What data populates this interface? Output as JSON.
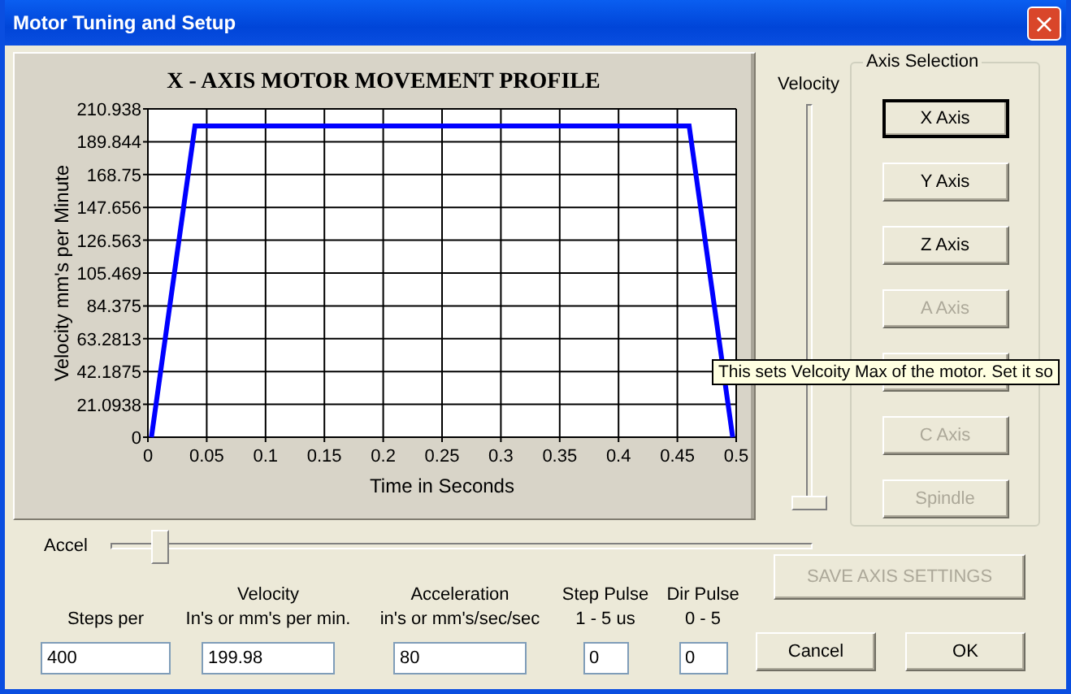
{
  "window": {
    "title": "Motor Tuning and Setup",
    "close": "×"
  },
  "chart": {
    "chart_data": {
      "type": "line",
      "title": "X - AXIS MOTOR MOVEMENT PROFILE",
      "xlabel": "Time in Seconds",
      "ylabel": "Velocity mm's per Minute",
      "x": [
        0.003,
        0.04,
        0.46,
        0.497
      ],
      "series": [
        {
          "color": "#0000ff",
          "values": [
            0,
            200,
            200,
            0
          ]
        }
      ],
      "grid": true,
      "xlim": [
        0,
        0.5
      ],
      "ylim": [
        0,
        210.938
      ],
      "xticks": [
        0,
        0.05,
        0.1,
        0.15,
        0.2,
        0.25,
        0.3,
        0.35,
        0.4,
        0.45,
        0.5
      ],
      "yticks": [
        0,
        21.0938,
        42.1875,
        63.2813,
        84.375,
        105.469,
        126.563,
        147.656,
        168.75,
        189.844,
        210.938
      ]
    }
  },
  "velocity_slider": {
    "label": "Velocity",
    "level": 0
  },
  "axis_selection": {
    "title": "Axis Selection",
    "buttons": [
      {
        "label": "X Axis",
        "selected": true,
        "disabled": false
      },
      {
        "label": "Y Axis",
        "selected": false,
        "disabled": false
      },
      {
        "label": "Z Axis",
        "selected": false,
        "disabled": false
      },
      {
        "label": "A Axis",
        "selected": false,
        "disabled": true
      },
      {
        "selected": false
      },
      {
        "label": "C Axis",
        "selected": false,
        "disabled": true
      },
      {
        "label": "Spindle",
        "selected": false,
        "disabled": true
      }
    ]
  },
  "accel_slider": {
    "label": "Accel",
    "level": 0.06
  },
  "fields": [
    {
      "label": "Steps per",
      "value": "400"
    },
    {
      "label": "Velocity",
      "sublabel": "In's or mm's per min.",
      "value": "199.98"
    },
    {
      "label": "Acceleration",
      "sublabel": "in's or mm's/sec/sec",
      "value": "80"
    },
    {
      "label": "Step Pulse",
      "sublabel": "1 - 5 us",
      "value": "0"
    },
    {
      "label": "Dir Pulse",
      "sublabel": "0 - 5",
      "value": "0"
    }
  ],
  "save_button": {
    "label": "SAVE AXIS SETTINGS",
    "disabled": true
  },
  "buttons": [
    "Cancel",
    "OK"
  ],
  "tooltip": "This sets Velcoity Max of the motor. Set it so"
}
